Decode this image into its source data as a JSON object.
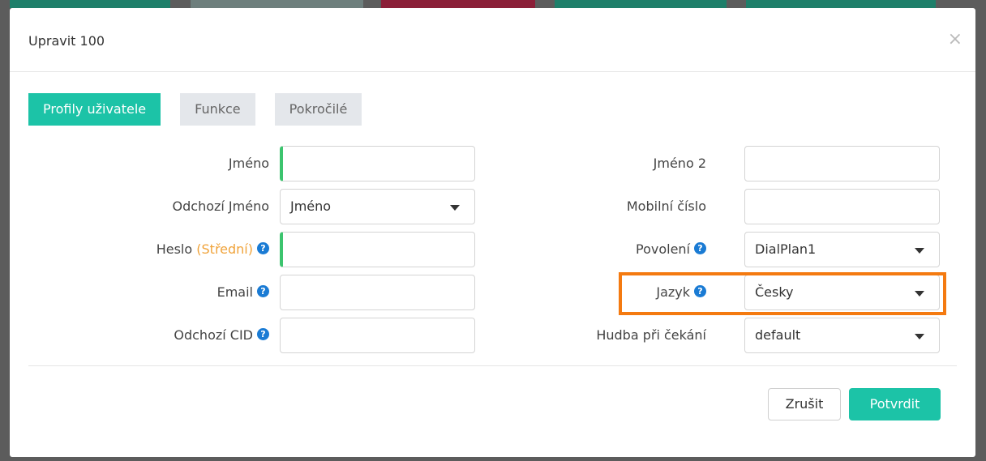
{
  "colors": {
    "accent": "#1cc3a7",
    "required_indicator": "#3cc46e",
    "help_icon": "#1a7bd4",
    "password_strength": "#f0a33a",
    "highlight_border": "#f47a10",
    "bg_bar_teal": "#1e7f6a",
    "bg_bar_gray": "#6e7f7d",
    "bg_bar_red": "#8b1f38"
  },
  "modal": {
    "title": "Upravit 100",
    "close_icon": "×"
  },
  "tabs": [
    {
      "label": "Profily uživatele",
      "active": true
    },
    {
      "label": "Funkce",
      "active": false
    },
    {
      "label": "Pokročilé",
      "active": false
    }
  ],
  "form": {
    "left": {
      "name": {
        "label": "Jméno",
        "value": ""
      },
      "outgoing_name": {
        "label": "Odchozí Jméno",
        "value": "Jméno"
      },
      "password": {
        "label": "Heslo",
        "strength": "(Střední)",
        "value": ""
      },
      "email": {
        "label": "Email",
        "value": ""
      },
      "outgoing_cid": {
        "label": "Odchozí CID",
        "value": ""
      }
    },
    "right": {
      "name2": {
        "label": "Jméno 2",
        "value": ""
      },
      "mobile": {
        "label": "Mobilní číslo",
        "value": ""
      },
      "permission": {
        "label": "Povolení",
        "value": "DialPlan1"
      },
      "language": {
        "label": "Jazyk",
        "value": "Česky"
      },
      "music_on_hold": {
        "label": "Hudba při čekání",
        "value": "default"
      }
    }
  },
  "footer": {
    "cancel_label": "Zrušit",
    "confirm_label": "Potvrdit"
  },
  "icons": {
    "help": "?"
  }
}
